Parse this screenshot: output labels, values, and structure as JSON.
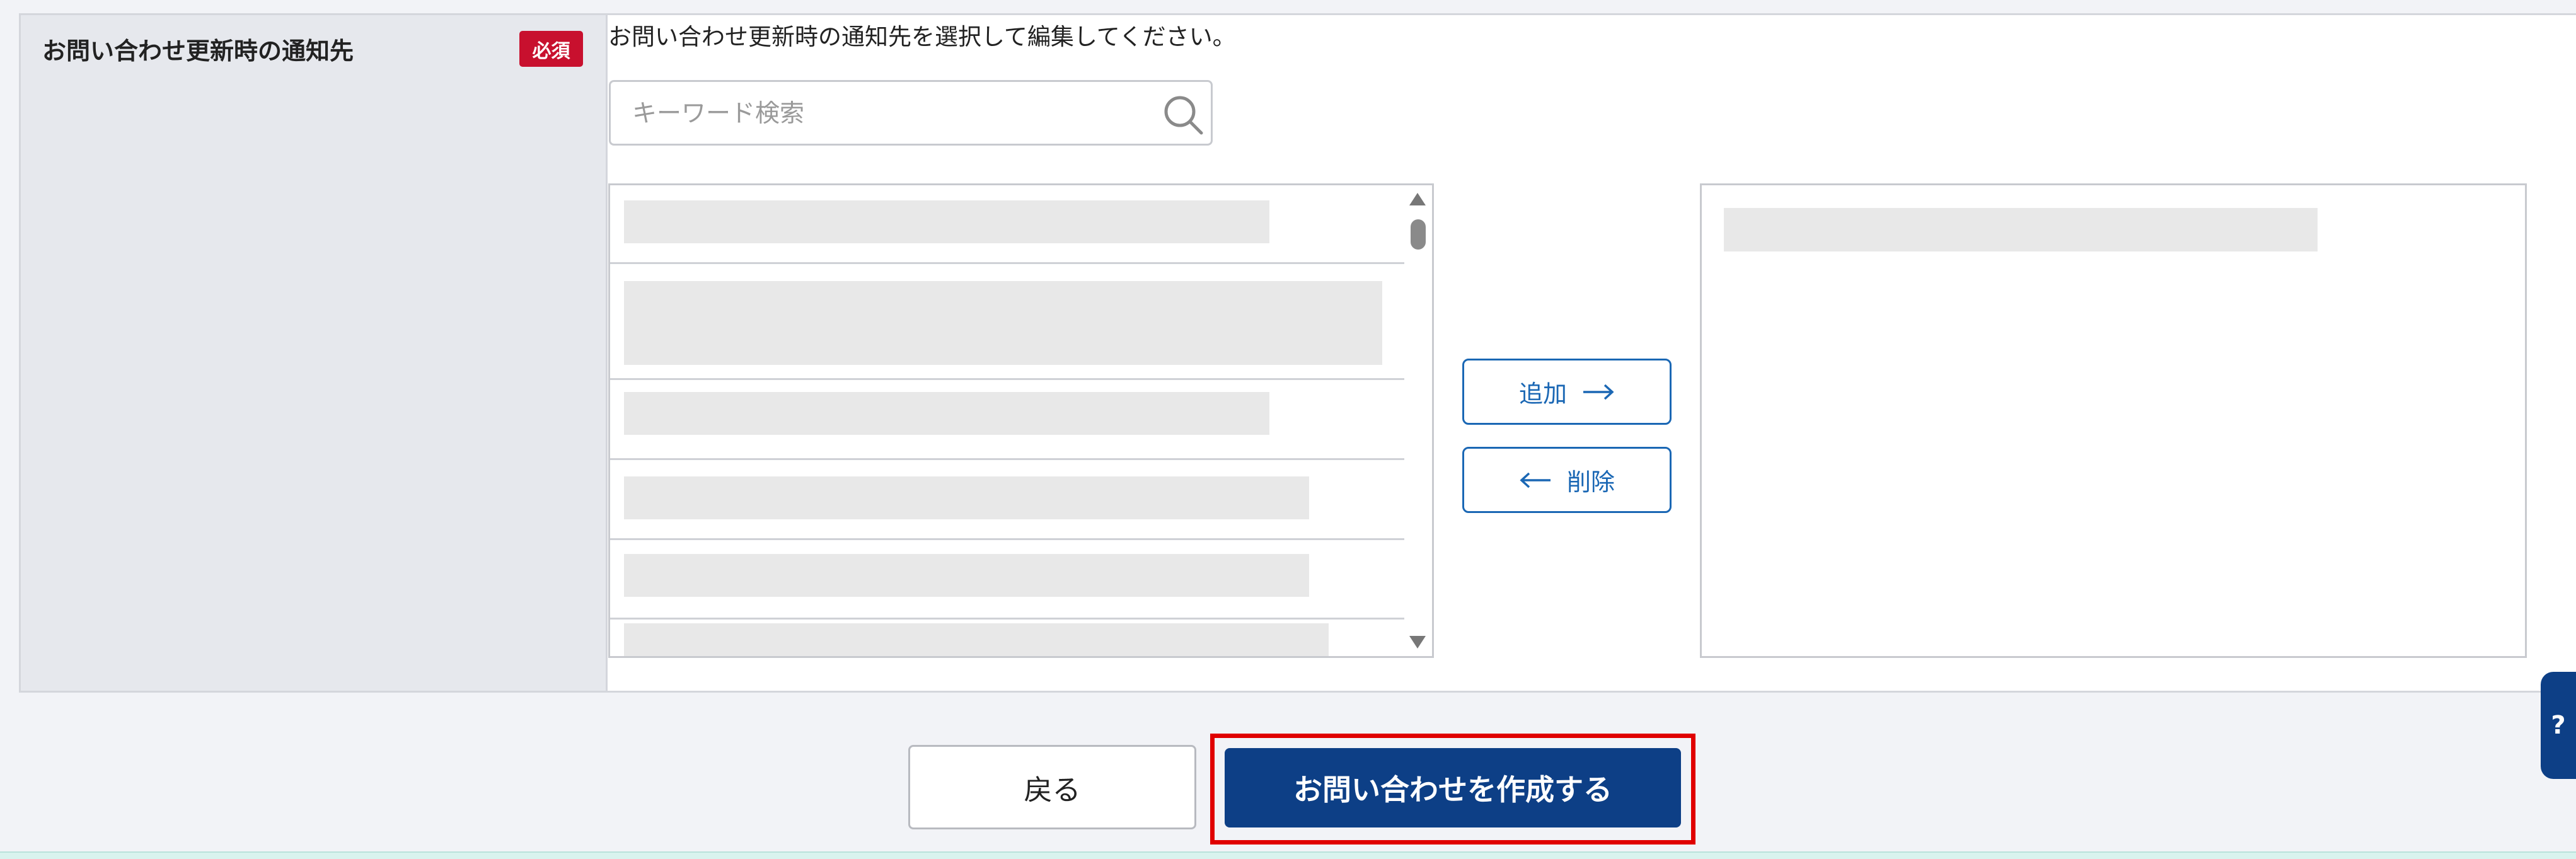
{
  "field": {
    "label": "お問い合わせ更新時の通知先",
    "required_badge": "必須",
    "instruction": "お問い合わせ更新時の通知先を選択して編集してください。"
  },
  "search": {
    "placeholder": "キーワード検索",
    "value": ""
  },
  "transfer": {
    "add_label": "追加",
    "remove_label": "削除"
  },
  "footer": {
    "back_label": "戻る",
    "create_label": "お問い合わせを作成する"
  },
  "side_tab": {
    "label": "?"
  },
  "colors": {
    "primary": "#0d3f86",
    "link_blue": "#1a67b4",
    "required_red": "#c8102e",
    "highlight_red": "#e00000",
    "skeleton": "#e8e8e8"
  },
  "icons": {
    "search": "search-icon",
    "add_arrow": "arrow-right-icon",
    "remove_arrow": "arrow-left-icon"
  }
}
